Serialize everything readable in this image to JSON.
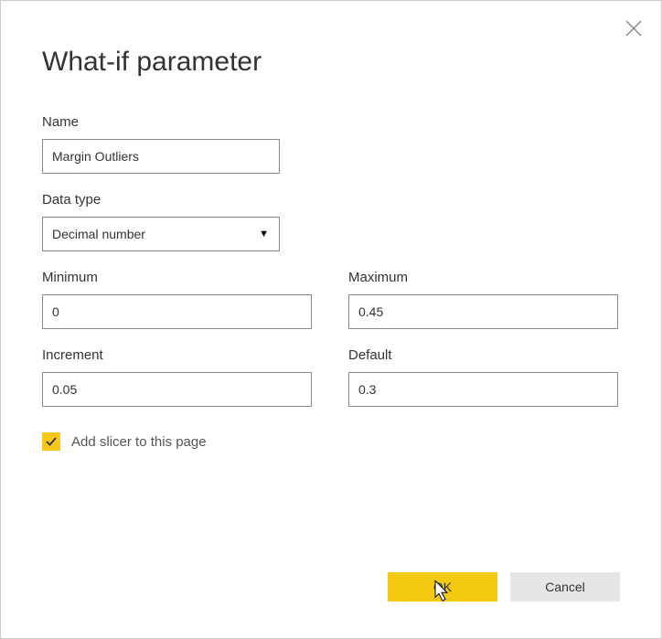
{
  "dialog": {
    "title": "What-if parameter",
    "close_icon": "close"
  },
  "fields": {
    "name": {
      "label": "Name",
      "value": "Margin Outliers"
    },
    "data_type": {
      "label": "Data type",
      "selected": "Decimal number"
    },
    "minimum": {
      "label": "Minimum",
      "value": "0"
    },
    "maximum": {
      "label": "Maximum",
      "value": "0.45"
    },
    "increment": {
      "label": "Increment",
      "value": "0.05"
    },
    "default": {
      "label": "Default",
      "value": "0.3"
    }
  },
  "checkbox": {
    "label": "Add slicer to this page",
    "checked": true
  },
  "buttons": {
    "ok": "OK",
    "cancel": "Cancel"
  }
}
